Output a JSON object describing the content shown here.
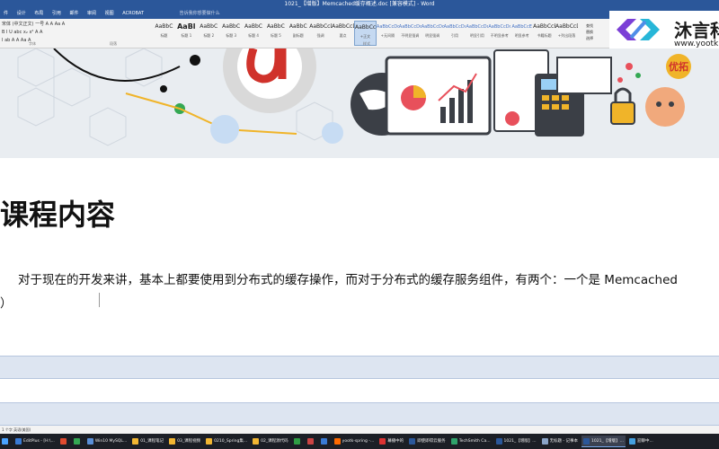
{
  "window": {
    "title": "1021_【增版】Memcached缓存概述.doc [兼容模式] - Word"
  },
  "menu": {
    "items": [
      "件",
      "设计",
      "布局",
      "引用",
      "邮件",
      "审阅",
      "视图",
      "ACROBAT"
    ],
    "search_placeholder": "告诉我你想要做什么"
  },
  "font_group": {
    "row1": "宋体 (中文正文)  一号  A A  Aa  A",
    "row2": "B I U abc x₂ x²  A  A",
    "row3": "I  ab  A  A  Aa  A",
    "label": "字体",
    "para_label": "段落"
  },
  "styles": {
    "label": "样式",
    "items": [
      {
        "sample": "AaBbC",
        "name": "标题"
      },
      {
        "sample": "AaBl",
        "name": "标题 1"
      },
      {
        "sample": "AaBbC",
        "name": "标题 2"
      },
      {
        "sample": "AaBbC",
        "name": "标题 3"
      },
      {
        "sample": "AaBbC",
        "name": "标题 4"
      },
      {
        "sample": "AaBbC",
        "name": "标题 5"
      },
      {
        "sample": "AaBbC",
        "name": "副标题"
      },
      {
        "sample": "AaBbCcDc",
        "name": "强调"
      },
      {
        "sample": "AaBbCcD",
        "name": "要点"
      },
      {
        "sample": "AaBbCcDc",
        "name": "+正文"
      },
      {
        "sample": "AaBbCcDc",
        "name": "+无间隔"
      },
      {
        "sample": "AaBbCcDc",
        "name": "不明显强调"
      },
      {
        "sample": "AaBbCcDc",
        "name": "明显强调"
      },
      {
        "sample": "AaBbCcDc",
        "name": "引用"
      },
      {
        "sample": "AaBbCcDc",
        "name": "明显引用"
      },
      {
        "sample": "AaBbCcDc",
        "name": "不明显参考"
      },
      {
        "sample": "AaBbCcE",
        "name": "明显参考"
      },
      {
        "sample": "AaBbCcE",
        "name": "书籍标题"
      },
      {
        "sample": "AaBbCcDc",
        "name": "+列出段落"
      }
    ]
  },
  "editing": {
    "find": "查找",
    "replace": "替换",
    "select": "选择"
  },
  "logo": {
    "name": "沐言科",
    "url": "www.yootk"
  },
  "banner": {
    "seal_text": "优拓"
  },
  "document": {
    "heading": "课程内容",
    "paragraph": "对于现在的开发来讲，基本上都要使用到分布式的缓存操作，而对于分布式的缓存服务组件，有两个：一个是 Memcached",
    "paragraph_cont": "）"
  },
  "status": {
    "text": "1 个字  英语(美国)"
  },
  "taskbar": {
    "items": [
      {
        "label": "EditPlus - [H:\\...",
        "color": "#3a7bd5"
      },
      {
        "label": "",
        "color": "#e04a2f"
      },
      {
        "label": "",
        "color": "#34a853"
      },
      {
        "label": "Win10 MySQL...",
        "color": "#5a8fd8"
      },
      {
        "label": "01_课程笔记",
        "color": "#f2b632"
      },
      {
        "label": "03_课程视频",
        "color": "#f2b632"
      },
      {
        "label": "0210_Spring集...",
        "color": "#f2b632"
      },
      {
        "label": "02_课程源代码",
        "color": "#f2b632"
      },
      {
        "label": "",
        "color": "#2f9e44"
      },
      {
        "label": "",
        "color": "#cc4444"
      },
      {
        "label": "",
        "color": "#3a7bd5"
      },
      {
        "label": "yootk-spring -...",
        "color": "#ff6a00"
      },
      {
        "label": "幕播中的",
        "color": "#d33"
      },
      {
        "label": "即使即得云服务",
        "color": "#2b579a"
      },
      {
        "label": "TechSmith Ca...",
        "color": "#2fa36b"
      },
      {
        "label": "1021_【增版】...",
        "color": "#2b579a"
      },
      {
        "label": "无标题 - 记事本",
        "color": "#8aa4c8"
      },
      {
        "label": "1021_【增版】...",
        "color": "#2b579a",
        "active": true
      },
      {
        "label": "迎聊中...",
        "color": "#44a0e0"
      }
    ]
  }
}
